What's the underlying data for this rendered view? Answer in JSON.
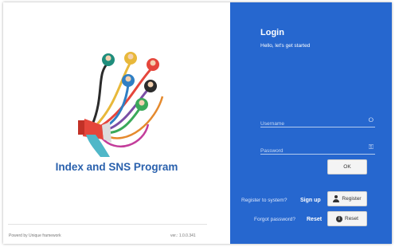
{
  "branding": {
    "app_title": "Index and SNS Program",
    "powered_by": "Powerd by Unique framework",
    "version": "ver.: 1.0.0.341"
  },
  "login": {
    "title": "Login",
    "subtitle": "Hello, let's get started",
    "username_placeholder": "Username",
    "password_placeholder": "Password",
    "ok_label": "OK",
    "register_question": "Register to system?",
    "signup_link": "Sign up",
    "register_label": "Register",
    "forgot_question": "Forgot password?",
    "reset_link": "Reset",
    "reset_label": "Reset"
  },
  "colors": {
    "panel_blue": "#2667cf",
    "title_blue": "#2a61ad"
  },
  "icons": {
    "username": "user-outline-icon",
    "password": "key-icon",
    "register": "user-icon",
    "reset": "info-icon"
  }
}
